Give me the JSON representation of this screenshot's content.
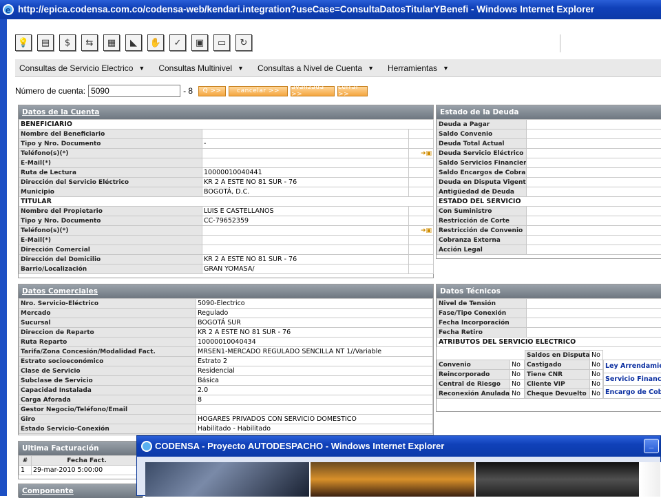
{
  "window": {
    "title": "http://epica.codensa.com.co/codensa-web/kendari.integration?useCase=ConsultaDatosTitularYBenefi - Windows Internet Explorer"
  },
  "toolbar": {
    "icons": [
      "lightbulb-icon",
      "report-icon",
      "money-bag-icon",
      "transfer-icon",
      "map-icon",
      "chart-icon",
      "handshake-icon",
      "approve-icon",
      "calculator-icon",
      "save-disk-icon",
      "refresh-icon"
    ]
  },
  "menu": {
    "items": [
      {
        "label": "Consultas de Servicio Electrico"
      },
      {
        "label": "Consultas Multinivel"
      },
      {
        "label": "Consultas a Nivel de Cuenta"
      },
      {
        "label": "Herramientas"
      }
    ]
  },
  "account": {
    "label": "Número de cuenta:",
    "value": "5090",
    "check_digit": "- 8",
    "buttons": {
      "search": "Q >>",
      "cancel": "cancelar >>",
      "advanced": "avanzada >>",
      "close": "cerrar >>"
    }
  },
  "datos_cuenta": {
    "title": "Datos de la Cuenta",
    "beneficiario_section": "BENEFICIARIO",
    "beneficiario_rows": [
      {
        "label": "Nombre del Beneficiario",
        "value": "",
        "icon": ""
      },
      {
        "label": "Tipo y Nro. Documento",
        "value": "-",
        "icon": ""
      },
      {
        "label": "Teléfono(s)(*)",
        "value": "",
        "icon": "➜▣"
      },
      {
        "label": "E-Mail(*)",
        "value": "",
        "icon": ""
      },
      {
        "label": "Ruta de Lectura",
        "value": "10000010040441",
        "icon": ""
      },
      {
        "label": "Dirección del Servicio Eléctrico",
        "value": "KR 2 A ESTE NO 81 SUR - 76",
        "icon": ""
      },
      {
        "label": "Municipio",
        "value": "BOGOTÁ, D.C.",
        "icon": ""
      }
    ],
    "titular_section": "TITULAR",
    "titular_rows": [
      {
        "label": "Nombre del Propietario",
        "value": "LUIS E CASTELLANOS",
        "icon": ""
      },
      {
        "label": "Tipo y Nro. Documento",
        "value": "CC-79652359",
        "icon": ""
      },
      {
        "label": "Teléfono(s)(*)",
        "value": "",
        "icon": "➜▣"
      },
      {
        "label": "E-Mail(*)",
        "value": "",
        "icon": ""
      },
      {
        "label": "Dirección Comercial",
        "value": "",
        "icon": ""
      },
      {
        "label": "Dirección del Domicilio",
        "value": "KR 2 A ESTE NO 81 SUR - 76",
        "icon": ""
      },
      {
        "label": "Barrio/Localización",
        "value": "GRAN YOMASA/",
        "icon": ""
      }
    ]
  },
  "estado_deuda": {
    "title": "Estado de la Deuda",
    "rows": [
      "Deuda a Pagar",
      "Saldo Convenio",
      "Deuda Total Actual",
      "Deuda Servicio Eléctrico",
      "Saldo Servicios Financieros",
      "Saldo Encargos de Cobranza",
      "Deuda en Disputa Vigente",
      "Antigüedad de Deuda"
    ],
    "servicio_section": "ESTADO DEL SERVICIO",
    "servicio_rows": [
      "Con Suministro",
      "Restricción de Corte",
      "Restricción de Convenio",
      "Cobranza Externa",
      "Acción Legal"
    ]
  },
  "datos_comerciales": {
    "title": "Datos Comerciales",
    "rows": [
      {
        "label": "Nro. Servicio-Eléctrico",
        "value": "5090-Electrico"
      },
      {
        "label": "Mercado",
        "value": "Regulado"
      },
      {
        "label": "Sucursal",
        "value": "BOGOTÁ SUR"
      },
      {
        "label": "Direccion de Reparto",
        "value": "KR 2 A ESTE NO 81 SUR - 76"
      },
      {
        "label": "Ruta Reparto",
        "value": "10000010040434"
      },
      {
        "label": "Tarifa/Zona Concesión/Modalidad Fact.",
        "value": "MRSEN1-MERCADO REGULADO SENCILLA NT 1//Variable"
      },
      {
        "label": "Estrato socioeconómico",
        "value": "Estrato 2"
      },
      {
        "label": "Clase de Servicio",
        "value": "Residencial"
      },
      {
        "label": "Subclase de Servicio",
        "value": "Básica"
      },
      {
        "label": "Capacidad Instalada",
        "value": "2.0"
      },
      {
        "label": "Carga Aforada",
        "value": "8"
      },
      {
        "label": "Gestor Negocio/Teléfono/Email",
        "value": ""
      },
      {
        "label": "Giro",
        "value": "HOGARES PRIVADOS CON SERVICIO DOMESTICO"
      },
      {
        "label": "Estado Servicio-Conexión",
        "value": "Habilitado - Habilitado"
      }
    ]
  },
  "datos_tecnicos": {
    "title": "Datos Técnicos",
    "rows": [
      "Nivel de Tensión",
      "Fase/Tipo Conexión",
      "Fecha Incorporación",
      "Fecha Retiro"
    ],
    "atributos_section": "ATRIBUTOS DEL SERVICIO ELECTRICO",
    "left_attrs": [
      {
        "label": "Convenio",
        "value": "No"
      },
      {
        "label": "Reincorporado",
        "value": "No"
      },
      {
        "label": "Central de Riesgo",
        "value": "No"
      },
      {
        "label": "Reconexión Anulada",
        "value": "No"
      }
    ],
    "mid_attrs": [
      {
        "label": "Saldos en Disputa",
        "value": "No"
      },
      {
        "label": "Castigado",
        "value": "No"
      },
      {
        "label": "Tiene CNR",
        "value": "No"
      },
      {
        "label": "Cliente VIP",
        "value": "No"
      },
      {
        "label": "Cheque Devuelto",
        "value": "No"
      }
    ],
    "right_links": [
      "Ley Arrendamie",
      "Servicio Financie",
      "Encargo de Cobr"
    ]
  },
  "ultima_facturacion": {
    "title": "Ultima Facturación",
    "columns": [
      "#",
      "Fecha Fact."
    ],
    "rows": [
      {
        "num": "1",
        "fecha": "29-mar-2010 5:00:00"
      }
    ]
  },
  "componente": {
    "title": "Componente"
  },
  "popup": {
    "title": "CODENSA - Proyecto AUTODESPACHO - Windows Internet Explorer",
    "min_label": "_"
  }
}
